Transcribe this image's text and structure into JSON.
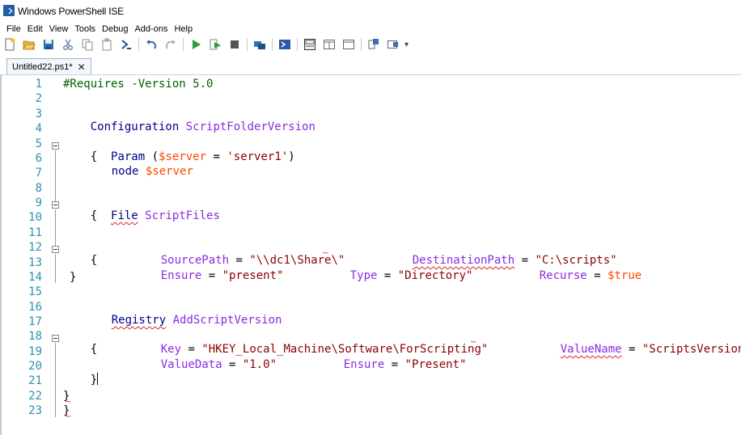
{
  "window": {
    "title": "Windows PowerShell ISE"
  },
  "menu": [
    "File",
    "Edit",
    "View",
    "Tools",
    "Debug",
    "Add-ons",
    "Help"
  ],
  "toolbar": {
    "icons": [
      "new-script-icon",
      "open-icon",
      "save-icon",
      "cut-icon",
      "copy-icon",
      "paste-icon",
      "console-icon",
      "undo-icon",
      "redo-icon",
      "run-icon",
      "run-selection-icon",
      "stop-icon",
      "remote-icon",
      "powershell-icon",
      "show-script-top-icon",
      "show-script-right-icon",
      "show-script-maximized-icon",
      "show-commands-icon",
      "show-addon-icon"
    ]
  },
  "tabs": [
    {
      "label": "Untitled22.ps1*"
    }
  ],
  "editor": {
    "line_numbers": [
      "1",
      "2",
      "3",
      "4",
      "5",
      "6",
      "7",
      "8",
      "9",
      "10",
      "11",
      "12",
      "13",
      "14",
      "15",
      "16",
      "17",
      "18",
      "19",
      "20",
      "21",
      "22",
      "23"
    ],
    "code": {
      "l1": "#Requires -Version 5.0",
      "l3_kw": "Configuration",
      "l3_name": "ScriptFolderVersion",
      "l5_brace": "{",
      "l5_kw": "Param",
      "l5_open": " (",
      "l5_var": "$server",
      "l5_eq": " = ",
      "l5_str": "'server1'",
      "l5_close": ")",
      "l6_kw": "node",
      "l6_var": "$server",
      "l9_brace": "{",
      "l9_kw": "File",
      "l9_name": "ScriptFiles",
      "l12_brace": "{",
      "l12_p1": "SourcePath",
      "l12_eq1": " = ",
      "l12_s1": "\"\\\\dc1\\Share\\\"",
      "l12_p2": "DestinationPath",
      "l12_eq2": " = ",
      "l12_s2": "\"C:\\scripts\"",
      "l13_p1": "Ensure",
      "l13_eq1": " = ",
      "l13_s1": "\"present\"",
      "l13_p2": "Type",
      "l13_eq2": " = ",
      "l13_s2": "\"Directory\"",
      "l13_p3": "Recurse",
      "l13_eq3": " = ",
      "l13_v3": "$true",
      "l14": "}",
      "l16_kw": "Registry",
      "l16_name": "AddScriptVersion",
      "l18_brace": "{",
      "l18_p1": "Key",
      "l18_eq1": " = ",
      "l18_s1": "\"HKEY_Local_Machine\\Software\\ForScripting\"",
      "l18_p2": "ValueName",
      "l18_eq2": " = ",
      "l18_s2": "\"ScriptsVersion\"",
      "l19_p1": "ValueData",
      "l19_eq1": " = ",
      "l19_s1": "\"1.0\"",
      "l19_p2": "Ensure",
      "l19_eq2": " = ",
      "l19_s2": "\"Present\"",
      "l20": "}",
      "l22": "}",
      "l23": "}"
    }
  },
  "colors": {
    "line_numbers": "#2b91af",
    "comment": "#006400",
    "keyword": "#00008b",
    "type_name": "#8a2be2",
    "variable": "#ff4500",
    "string": "#8b0000",
    "error_squiggle": "#e02020"
  }
}
